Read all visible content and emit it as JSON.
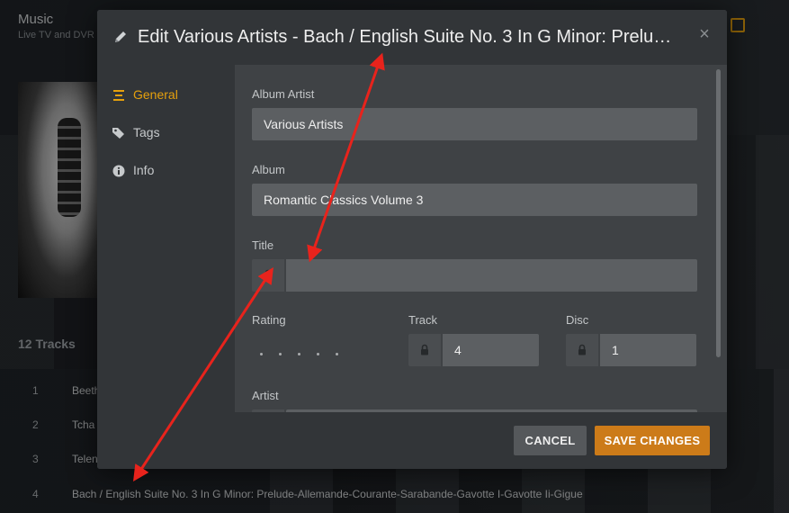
{
  "background": {
    "title": "Music",
    "subtitle": "Live TV and DVR",
    "tracks_heading": "12 Tracks",
    "tracks": [
      {
        "num": "1",
        "name": "Beeth"
      },
      {
        "num": "2",
        "name": "Tcha"
      },
      {
        "num": "3",
        "name": "Telen"
      },
      {
        "num": "4",
        "name": "Bach / English Suite No. 3 In G Minor: Prelude-Allemande-Courante-Sarabande-Gavotte I-Gavotte Ii-Gigue"
      }
    ]
  },
  "modal": {
    "title": "Edit Various Artists - Bach / English Suite No. 3 In G Minor: Prelud...",
    "close_label": "×",
    "sidebar": {
      "items": [
        {
          "label": "General",
          "icon": "list-icon",
          "active": true
        },
        {
          "label": "Tags",
          "icon": "tags-icon",
          "active": false
        },
        {
          "label": "Info",
          "icon": "info-icon",
          "active": false
        }
      ]
    },
    "fields": {
      "album_artist": {
        "label": "Album Artist",
        "value": "Various Artists"
      },
      "album": {
        "label": "Album",
        "value": "Romantic Classics Volume 3"
      },
      "title": {
        "label": "Title",
        "value": ""
      },
      "rating": {
        "label": "Rating",
        "stars": 5,
        "value": 0
      },
      "track": {
        "label": "Track",
        "value": "4"
      },
      "disc": {
        "label": "Disc",
        "value": "1"
      },
      "artist": {
        "label": "Artist",
        "value": ""
      }
    },
    "footer": {
      "cancel_label": "CANCEL",
      "save_label": "SAVE CHANGES"
    }
  },
  "colors": {
    "accent": "#e5a00d",
    "save_button": "#cc7b19",
    "annotation_arrow": "#e8231c"
  }
}
